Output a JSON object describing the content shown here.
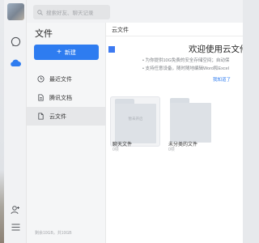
{
  "search": {
    "placeholder": "搜索好友、聊天记录"
  },
  "sidebar": {
    "title": "文件",
    "new_button": "新建",
    "items": [
      {
        "label": "最近文件",
        "icon": "clock-icon"
      },
      {
        "label": "腾讯文档",
        "icon": "document-icon"
      },
      {
        "label": "云文件",
        "icon": "cloud-file-icon",
        "active": true
      }
    ],
    "storage": "剩余10GB，共10GB"
  },
  "main": {
    "breadcrumb": "云文件",
    "banner": {
      "title": "欢迎使用云文件",
      "bullets": [
        "• 为你提供10G免费的安全存储空间；自动保",
        "• 支持任意设备，随时随地编辑Word和Excel"
      ],
      "link": "我知道了"
    },
    "folders": [
      {
        "name": "聊天文件",
        "count": "0项",
        "tag": "暂未开启"
      },
      {
        "name": "未分类的文件",
        "count": "0项",
        "tag": ""
      }
    ]
  },
  "colors": {
    "accent": "#2e7cf0"
  }
}
